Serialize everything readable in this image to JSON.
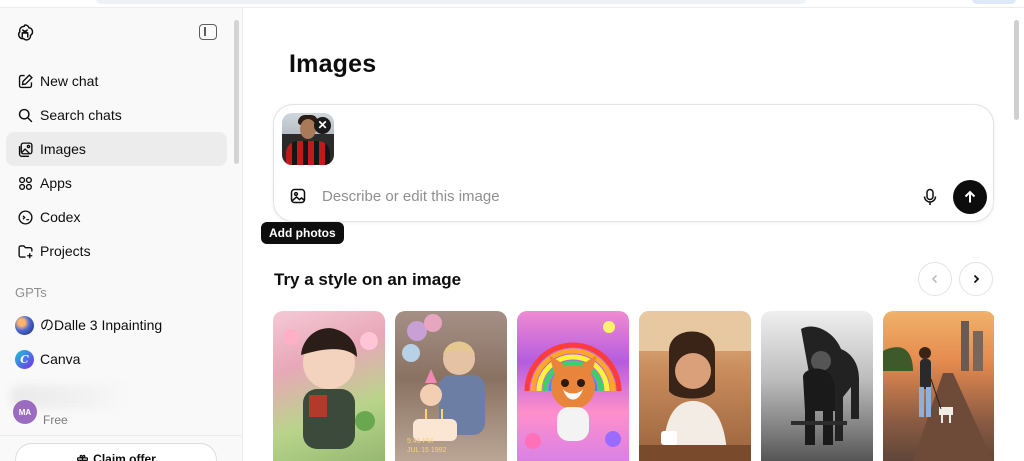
{
  "sidebar": {
    "nav": [
      {
        "label": "New chat",
        "icon": "new-chat-icon"
      },
      {
        "label": "Search chats",
        "icon": "search-icon"
      },
      {
        "label": "Images",
        "icon": "images-icon",
        "active": true
      },
      {
        "label": "Apps",
        "icon": "apps-icon"
      },
      {
        "label": "Codex",
        "icon": "codex-icon"
      },
      {
        "label": "Projects",
        "icon": "folder-plus-icon"
      }
    ],
    "gpts_label": "GPTs",
    "gpts": [
      {
        "label": "のDalle 3 Inpainting",
        "icon": "dalle-avatar"
      },
      {
        "label": "Canva",
        "icon": "canva-avatar",
        "glyph": "C"
      }
    ],
    "user": {
      "initials": "MA",
      "plan": "Free"
    },
    "claim_offer": "Claim offer"
  },
  "main": {
    "title": "Images",
    "composer": {
      "placeholder": "Describe or edit this image",
      "thumbnail_close": "✕"
    },
    "tooltip": "Add photos",
    "styles_title": "Try a style on an image",
    "colors": {
      "send_button": "#0d0d0d",
      "active_nav": "#ececec",
      "sidebar_bg": "#f9f9f9"
    }
  }
}
